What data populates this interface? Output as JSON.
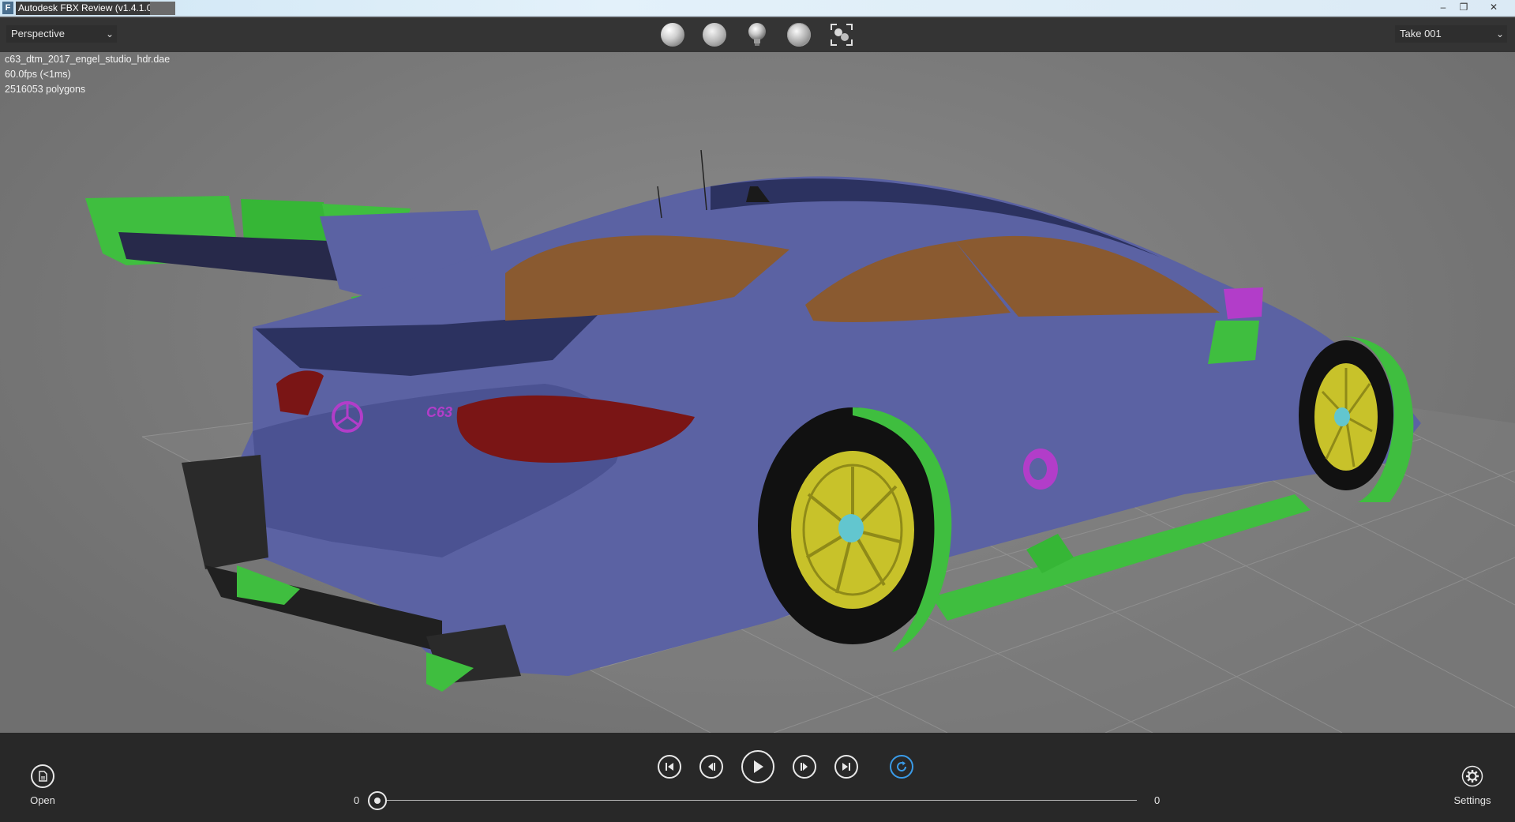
{
  "window": {
    "title": "Autodesk FBX Review (v1.4.1.0)",
    "app_icon_letter": "F",
    "minimize": "–",
    "restore": "❐",
    "close": "✕"
  },
  "toolbar": {
    "camera_select": "Perspective",
    "take_select": "Take 001",
    "chevron": "⌄",
    "render_buttons": [
      "shaded-sphere-icon",
      "smooth-sphere-icon",
      "light-bulb-icon",
      "wireframe-sphere-icon",
      "frame-all-icon"
    ]
  },
  "viewport": {
    "file_name": "c63_dtm_2017_engel_studio_hdr.dae",
    "fps": "60.0fps (<1ms)",
    "polygons": "2516053 polygons",
    "badge_text": "C63",
    "colors": {
      "body": "#5b62a3",
      "wing": "#3fbe3f",
      "rim": "#c8c22a",
      "glass": "#8a5a30",
      "taillight": "#7a1515",
      "accent": "#b23dc9"
    }
  },
  "bottom": {
    "open_label": "Open",
    "settings_label": "Settings",
    "range_start": "0",
    "range_end": "0",
    "playback_position": 0,
    "transport": [
      "go-to-start-icon",
      "previous-frame-icon",
      "play-icon",
      "next-frame-icon",
      "go-to-end-icon",
      "loop-icon"
    ]
  }
}
